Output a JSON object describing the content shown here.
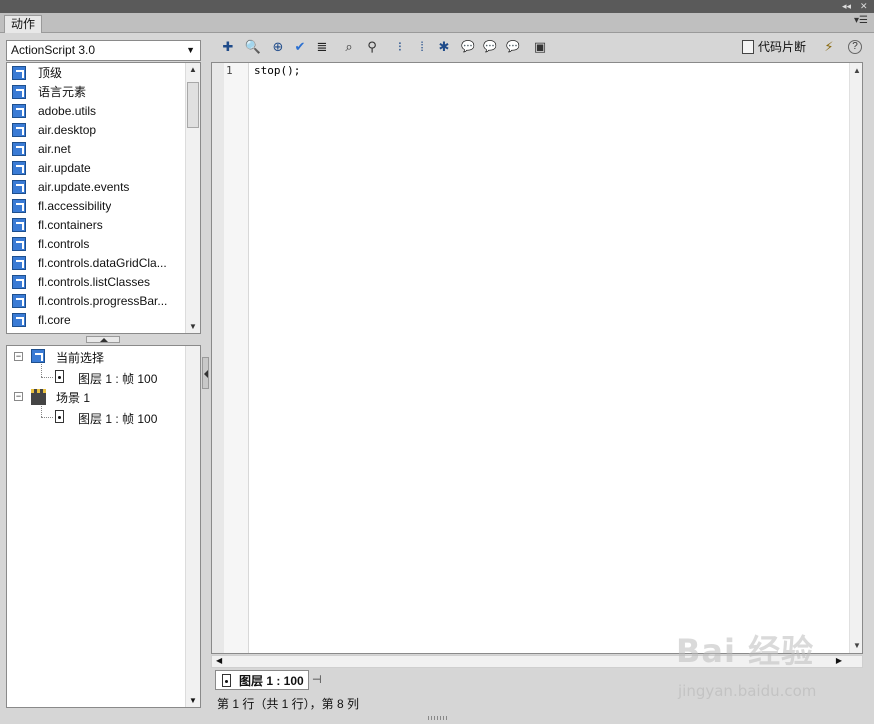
{
  "panel": {
    "tab_label": "动作",
    "collapse_glyph": "◂◂",
    "close_glyph": "✕",
    "menu_glyph": "▾☰"
  },
  "language_select": {
    "value": "ActionScript 3.0"
  },
  "toolbox": {
    "items": [
      {
        "label": "顶级"
      },
      {
        "label": "语言元素"
      },
      {
        "label": "adobe.utils"
      },
      {
        "label": "air.desktop"
      },
      {
        "label": "air.net"
      },
      {
        "label": "air.update"
      },
      {
        "label": "air.update.events"
      },
      {
        "label": "fl.accessibility"
      },
      {
        "label": "fl.containers"
      },
      {
        "label": "fl.controls"
      },
      {
        "label": "fl.controls.dataGridCla..."
      },
      {
        "label": "fl.controls.listClasses"
      },
      {
        "label": "fl.controls.progressBar..."
      },
      {
        "label": "fl.core"
      }
    ]
  },
  "script_navigator": {
    "current_selection": {
      "label": "当前选择",
      "child": "图层 1 : 帧 100"
    },
    "scene": {
      "label": "场景 1",
      "child": "图层 1 : 帧 100"
    }
  },
  "toolbar": {
    "tools": [
      {
        "name": "add-new-item-icon",
        "glyph": "✚"
      },
      {
        "name": "find-icon",
        "glyph": "🔍"
      },
      {
        "name": "insert-target-path-icon",
        "glyph": "⊕"
      },
      {
        "name": "check-syntax-icon",
        "glyph": "✔"
      },
      {
        "name": "auto-format-icon",
        "glyph": "≣"
      },
      {
        "name": "show-code-hint-icon",
        "glyph": "⌕"
      },
      {
        "name": "debug-options-icon",
        "glyph": "⚲"
      },
      {
        "name": "collapse-between-braces-icon",
        "glyph": "⁝"
      },
      {
        "name": "collapse-selection-icon",
        "glyph": "⁞"
      },
      {
        "name": "expand-all-icon",
        "glyph": "✱"
      },
      {
        "name": "apply-block-comment-icon",
        "glyph": "💬"
      },
      {
        "name": "apply-line-comment-icon",
        "glyph": "💬"
      },
      {
        "name": "remove-comment-icon",
        "glyph": "💬"
      },
      {
        "name": "show-hide-toolbox-icon",
        "glyph": "▣"
      }
    ],
    "snippet_label": "代码片断",
    "wand_glyph": "⚡",
    "help_glyph": "?"
  },
  "editor": {
    "line_number": "1",
    "code": "stop();"
  },
  "script_tab": {
    "label": "图层 1 : 100",
    "pin_glyph": "⊣"
  },
  "status": {
    "text": "第 1 行（共 1 行），第 8 列"
  },
  "watermark": {
    "logo": "Bai 经验",
    "url": "jingyan.baidu.com"
  }
}
